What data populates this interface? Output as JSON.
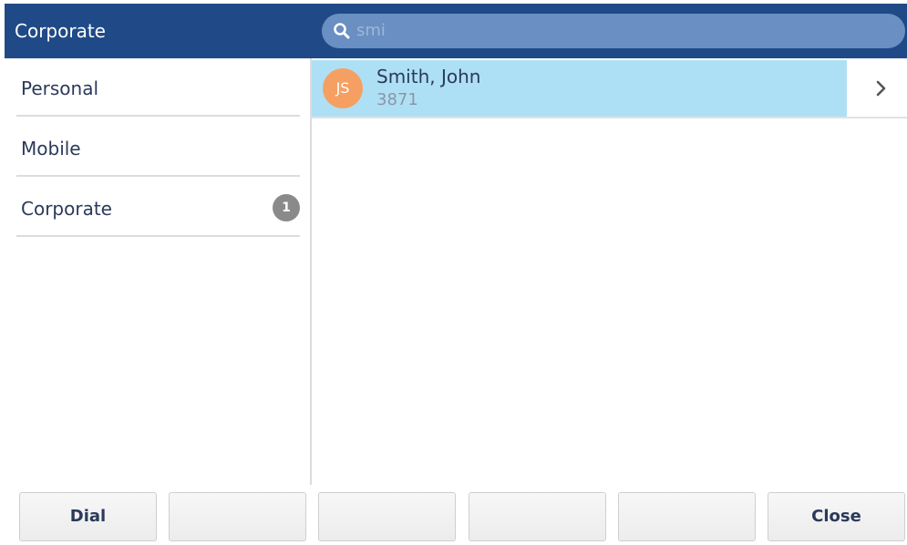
{
  "header": {
    "title": "Corporate",
    "search": {
      "value": "smi",
      "icon": "search-icon"
    }
  },
  "sidebar": {
    "items": [
      {
        "label": "Personal",
        "badge": ""
      },
      {
        "label": "Mobile",
        "badge": ""
      },
      {
        "label": "Corporate",
        "badge": "1"
      }
    ]
  },
  "results": [
    {
      "initials": "JS",
      "name": "Smith, John",
      "number": "3871",
      "icon": "chevron-right-icon"
    }
  ],
  "softkeys": [
    "Dial",
    "",
    "",
    "",
    "",
    "Close"
  ],
  "colors": {
    "header_bg": "#1f4a87",
    "search_bg": "#6a8fc2",
    "highlight": "#aee0f5",
    "avatar": "#f5a062",
    "badge": "#8a8a8a"
  }
}
